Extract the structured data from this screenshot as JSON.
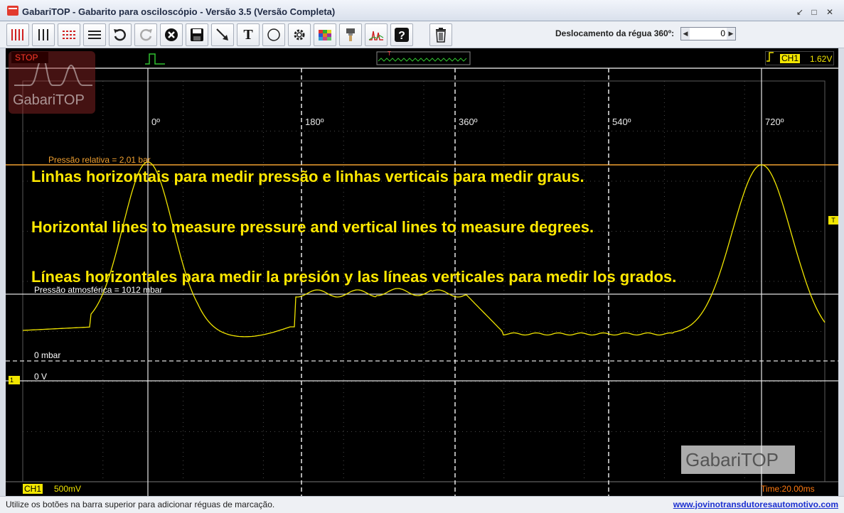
{
  "window": {
    "title": "GabariTOP - Gabarito para osciloscópio - Versão 3.5 (Versão Completa)",
    "controls": [
      "minimize-icon",
      "maximize-icon",
      "close-icon"
    ]
  },
  "toolbar": {
    "buttons": [
      {
        "name": "vertical-ruler-red-icon"
      },
      {
        "name": "vertical-ruler-black-icon"
      },
      {
        "name": "horizontal-ruler-red-icon"
      },
      {
        "name": "horizontal-ruler-black-icon"
      },
      {
        "name": "undo-icon"
      },
      {
        "name": "redo-icon"
      },
      {
        "name": "delete-icon"
      },
      {
        "name": "save-icon"
      },
      {
        "name": "arrow-tool-icon"
      },
      {
        "name": "text-tool-icon",
        "label": "T"
      },
      {
        "name": "circle-tool-icon"
      },
      {
        "name": "settings-icon"
      },
      {
        "name": "palette-icon"
      },
      {
        "name": "brush-icon"
      },
      {
        "name": "waveform-icon"
      },
      {
        "name": "help-icon",
        "label": "?"
      },
      {
        "name": "trash-icon"
      }
    ],
    "ruler_offset_label": "Deslocamento da régua 360º:",
    "ruler_offset_value": "0"
  },
  "scope": {
    "stop_label": "STOP",
    "watermark_top": "GabariTOP",
    "watermark_bottom": "GabariTOP",
    "channel_top": "CH1",
    "channel_top_value": "1.62V",
    "degree_labels": [
      "0º",
      "180º",
      "360º",
      "540º",
      "720º"
    ],
    "pressure_relative": "Pressão relativa = 2,01 bar",
    "pressure_atmospheric": "Pressão atmosférica = 1012 mbar",
    "zero_mbar": "0 mbar",
    "zero_volt": "0 V",
    "overlay": {
      "pt": "Linhas horizontais para medir pressão e linhas verticais para medir graus.",
      "en": "Horizontal lines to measure pressure and vertical lines to measure degrees.",
      "es": "Líneas horizontales para medir la presión y las líneas verticales para medir los grados."
    },
    "channel_bottom": "CH1",
    "channel_bottom_scale": "500mV",
    "time_label": "Time:20.00ms",
    "trigger_marker": "T",
    "channel_marker": "1",
    "colors": {
      "trace": "#f2e600",
      "pressure_line": "#f0a030",
      "background": "#000000",
      "grid": "#5a5a5a"
    }
  },
  "status": {
    "hint": "Utilize os botões na barra superior para adicionar réguas de marcação.",
    "link": "www.jovinotransdutoresautomotivo.com"
  }
}
